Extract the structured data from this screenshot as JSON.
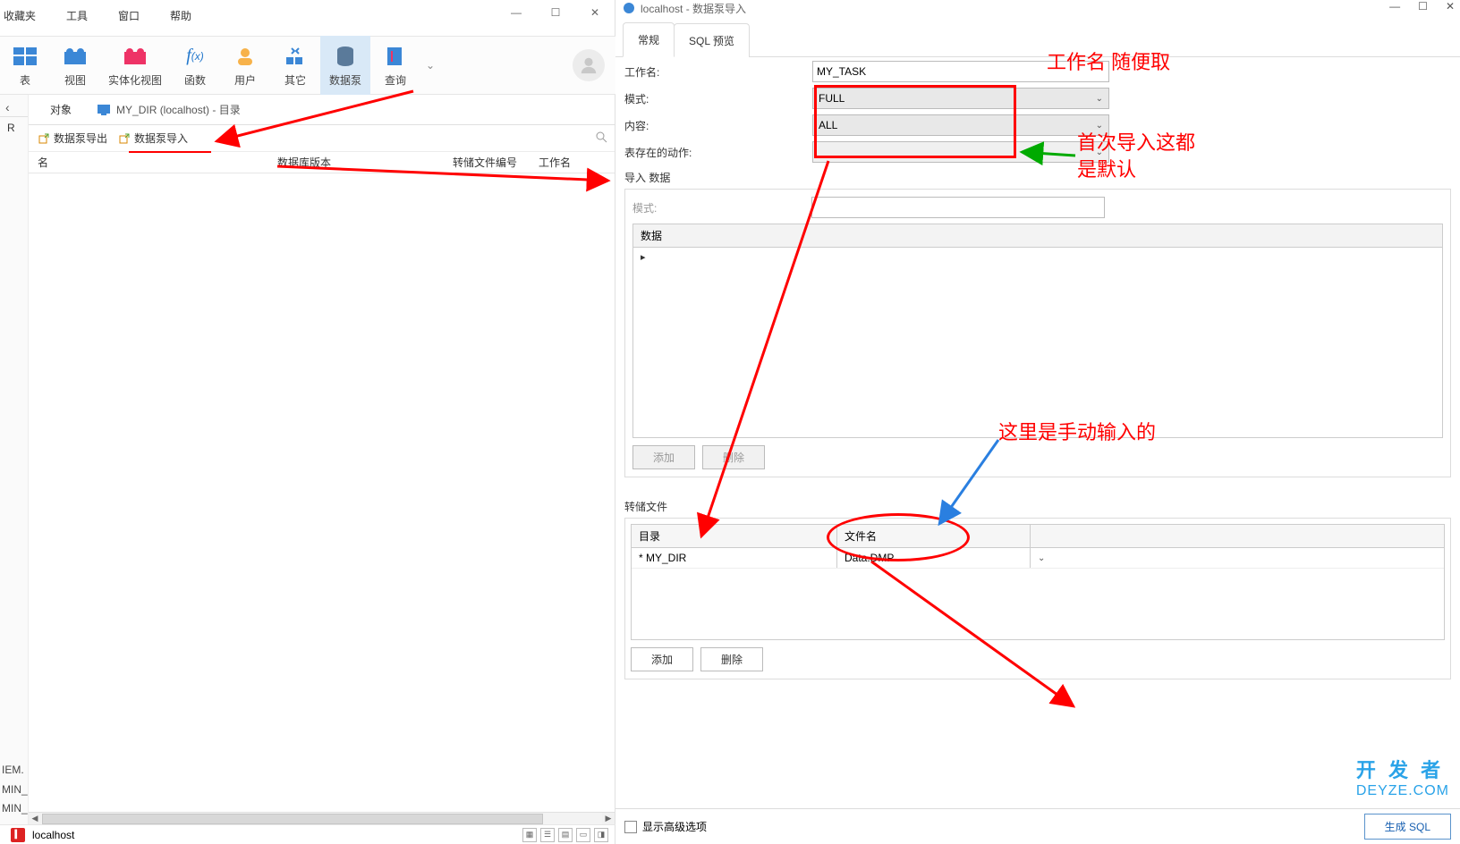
{
  "left": {
    "menubar": [
      "收藏夹",
      "工具",
      "窗口",
      "帮助"
    ],
    "winctrl": {
      "min": "—",
      "max": "☐",
      "close": "✕"
    },
    "toolbar": {
      "table": "表",
      "view": "视图",
      "matview": "实体化视图",
      "func": "函数",
      "user": "用户",
      "other": "其它",
      "datapump": "数据泵",
      "query": "查询"
    },
    "tabs": {
      "obj": "对象",
      "dirlabel": "MY_DIR (localhost) - 目录"
    },
    "actions": {
      "export": "数据泵导出",
      "import": "数据泵导入"
    },
    "cols": {
      "name": "名",
      "dbver": "数据库版本",
      "dumpno": "转储文件编号",
      "job": "工作名"
    },
    "sidebar_bottom": [
      "IEM.",
      "MIN_",
      "MIN_"
    ],
    "status": "localhost"
  },
  "dlg": {
    "title": "localhost - 数据泵导入",
    "tabs": {
      "general": "常规",
      "sql": "SQL 预览"
    },
    "labels": {
      "jobname": "工作名:",
      "mode": "模式:",
      "content": "内容:",
      "exists": "表存在的动作:",
      "importdata": "导入 数据",
      "innermode": "模式:",
      "datacol": "数据",
      "add": "添加",
      "del": "删除",
      "dumpfile": "转储文件",
      "dir": "目录",
      "filename": "文件名",
      "add2": "添加",
      "del2": "删除",
      "advanced": "显示高级选项",
      "gensql": "生成 SQL"
    },
    "values": {
      "jobname": "MY_TASK",
      "mode": "FULL",
      "content": "ALL",
      "exists": "",
      "dir": "* MY_DIR",
      "filename": "Data.DMP"
    }
  },
  "annotations": {
    "jobname": "工作名 随便取",
    "defaults1": "首次导入这都",
    "defaults2": "是默认",
    "manual": "这里是手动输入的"
  },
  "watermark": {
    "l1": "开 发 者",
    "l2": "DEYZE.COM"
  }
}
